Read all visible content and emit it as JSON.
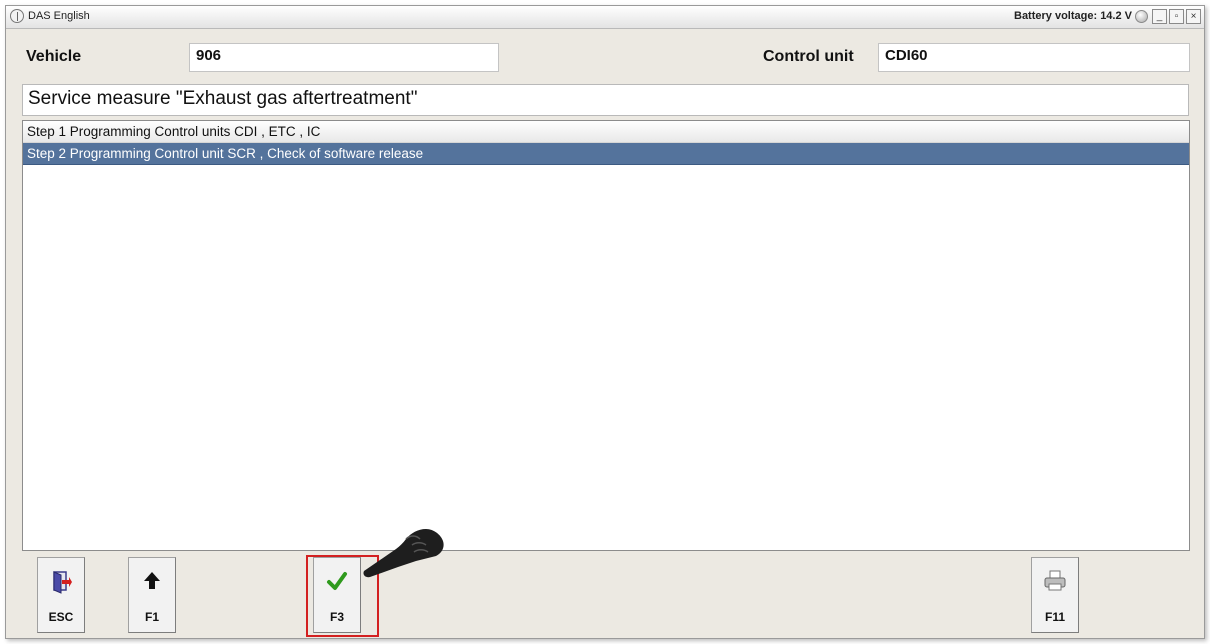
{
  "window": {
    "title": "DAS English",
    "battery_label": "Battery voltage: 14.2 V",
    "buttons": {
      "minimize": "_",
      "maximize": "▫",
      "close": "×"
    }
  },
  "header": {
    "vehicle_label": "Vehicle",
    "vehicle_value": "906",
    "control_unit_label": "Control unit",
    "control_unit_value": "CDI60"
  },
  "service_measure": "Service measure \"Exhaust gas aftertreatment\"",
  "steps": [
    {
      "label": "Step 1 Programming Control units CDI , ETC , IC",
      "selected": false
    },
    {
      "label": "Step 2 Programming Control unit SCR , Check of software release",
      "selected": true
    }
  ],
  "function_keys": [
    {
      "label": "ESC",
      "icon": "exit-door-icon"
    },
    {
      "label": "F1",
      "icon": "up-arrow-icon"
    },
    {
      "label": "F3",
      "icon": "green-check-icon",
      "highlighted": true
    },
    {
      "label": "F11",
      "icon": "printer-icon"
    }
  ],
  "colors": {
    "selection": "#54739c",
    "highlight_box": "#d32020",
    "check": "#2f9a1d"
  }
}
